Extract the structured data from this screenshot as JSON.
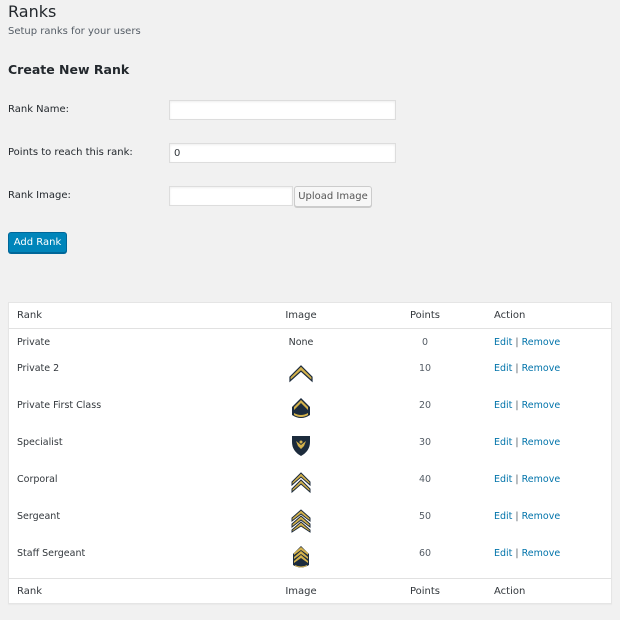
{
  "header": {
    "title": "Ranks",
    "subtitle": "Setup ranks for your users"
  },
  "form": {
    "section_title": "Create New Rank",
    "rank_name_label": "Rank Name:",
    "rank_name_value": "",
    "points_label": "Points to reach this rank:",
    "points_value": "0",
    "image_label": "Rank Image:",
    "image_value": "",
    "upload_button": "Upload Image",
    "add_button": "Add Rank"
  },
  "table": {
    "columns": [
      "Rank",
      "Image",
      "Points",
      "Action"
    ],
    "rows": [
      {
        "rank": "Private",
        "image": "None",
        "points": "0",
        "edit": "Edit",
        "remove": "Remove"
      },
      {
        "rank": "Private 2",
        "image": "single-chevron-icon",
        "points": "10",
        "edit": "Edit",
        "remove": "Remove"
      },
      {
        "rank": "Private First Class",
        "image": "chevron-rocker-icon",
        "points": "20",
        "edit": "Edit",
        "remove": "Remove"
      },
      {
        "rank": "Specialist",
        "image": "eagle-shield-icon",
        "points": "30",
        "edit": "Edit",
        "remove": "Remove"
      },
      {
        "rank": "Corporal",
        "image": "double-chevron-icon",
        "points": "40",
        "edit": "Edit",
        "remove": "Remove"
      },
      {
        "rank": "Sergeant",
        "image": "triple-chevron-icon",
        "points": "50",
        "edit": "Edit",
        "remove": "Remove"
      },
      {
        "rank": "Staff Sergeant",
        "image": "triple-chevron-rocker-icon",
        "points": "60",
        "edit": "Edit",
        "remove": "Remove"
      }
    ],
    "separator": "|"
  },
  "colors": {
    "primary": "#0085ba",
    "link": "#0073aa",
    "insignia_gold": "#d4b24c",
    "insignia_dark": "#1c2b3c"
  }
}
